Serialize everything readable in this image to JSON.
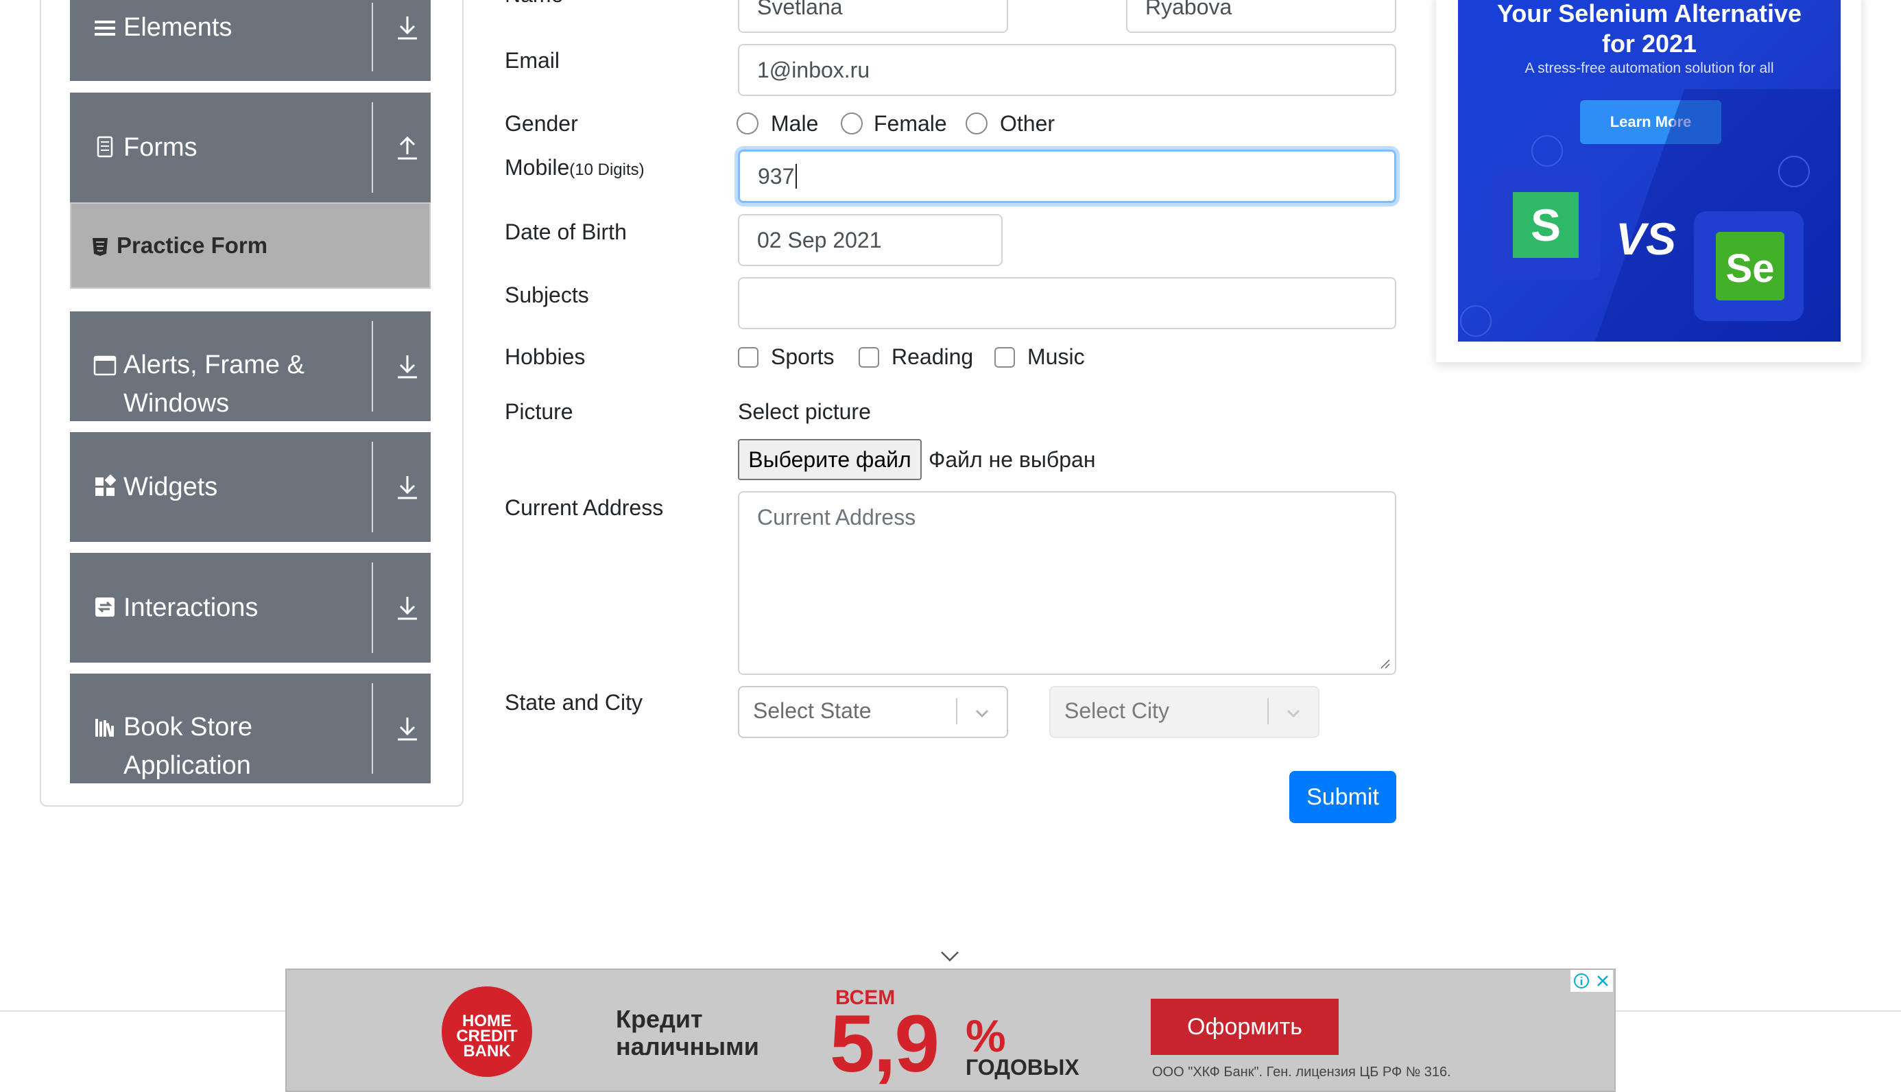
{
  "sidebar": {
    "groups": [
      {
        "label": "Elements",
        "icon": "hamburger-icon"
      },
      {
        "label": "Forms",
        "icon": "document-icon"
      },
      {
        "label": "Alerts, Frame &",
        "label2": "Windows",
        "icon": "window-icon"
      },
      {
        "label": "Widgets",
        "icon": "widgets-icon"
      },
      {
        "label": "Interactions",
        "icon": "interactions-icon"
      },
      {
        "label": "Book Store",
        "label2": "Application",
        "icon": "bookstore-icon"
      }
    ],
    "active_item": "Practice Form"
  },
  "form": {
    "name_label": "Name",
    "first_name": "Svetlana",
    "last_name": "Ryabova",
    "email_label": "Email",
    "email": "1@inbox.ru",
    "gender_label": "Gender",
    "genders": [
      "Male",
      "Female",
      "Other"
    ],
    "mobile_label": "Mobile",
    "mobile_hint": "(10 Digits)",
    "mobile": "937",
    "dob_label": "Date of Birth",
    "dob": "02 Sep 2021",
    "subjects_label": "Subjects",
    "hobbies_label": "Hobbies",
    "hobbies": [
      "Sports",
      "Reading",
      "Music"
    ],
    "picture_label": "Picture",
    "picture_hint": "Select picture",
    "file_button": "Выберите файл",
    "file_status": "Файл не выбран",
    "address_label": "Current Address",
    "address_placeholder": "Current Address",
    "state_city_label": "State and City",
    "state_placeholder": "Select State",
    "city_placeholder": "Select City",
    "submit": "Submit"
  },
  "ad_right": {
    "title_line1": "Your Selenium Alternative",
    "title_line2": "for 2021",
    "subtitle": "A stress-free automation solution for all",
    "button": "Learn More",
    "vs": "VS",
    "logo_left": "S",
    "logo_right": "Se"
  },
  "ad_bottom": {
    "logo": [
      "HOME",
      "CREDIT",
      "BANK"
    ],
    "credit_line1": "Кредит",
    "credit_line2": "наличными",
    "vsem": "ВСЕМ",
    "rate": "5,9",
    "percent": "%",
    "annual": "ГОДОВЫХ",
    "cta": "Оформить",
    "legal": "ООО \"ХКФ Банк\". Ген. лицензия ЦБ РФ № 316."
  },
  "colors": {
    "sidebar_group": "#6c737d",
    "active_item": "#b0b0b0",
    "primary": "#007bff",
    "ad_blue": "#1640d8",
    "bank_red": "#d2232a"
  }
}
